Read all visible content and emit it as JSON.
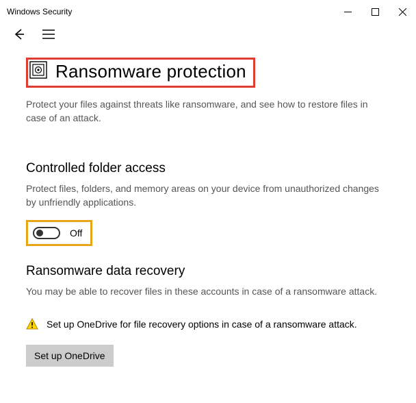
{
  "titlebar": {
    "app_title": "Windows Security"
  },
  "page": {
    "title": "Ransomware protection",
    "description": "Protect your files against threats like ransomware, and see how to restore files in case of an attack."
  },
  "controlled_folder": {
    "title": "Controlled folder access",
    "description": "Protect files, folders, and memory areas on your device from unauthorized changes by unfriendly applications.",
    "toggle_state_label": "Off"
  },
  "data_recovery": {
    "title": "Ransomware data recovery",
    "description": "You may be able to recover files in these accounts in case of a ransomware attack.",
    "onedrive_hint": "Set up OneDrive for file recovery options in case of a ransomware attack.",
    "setup_button_label": "Set up OneDrive"
  },
  "highlight_colors": {
    "red_box": "#E03C31",
    "yellow_box": "#E7A614"
  }
}
